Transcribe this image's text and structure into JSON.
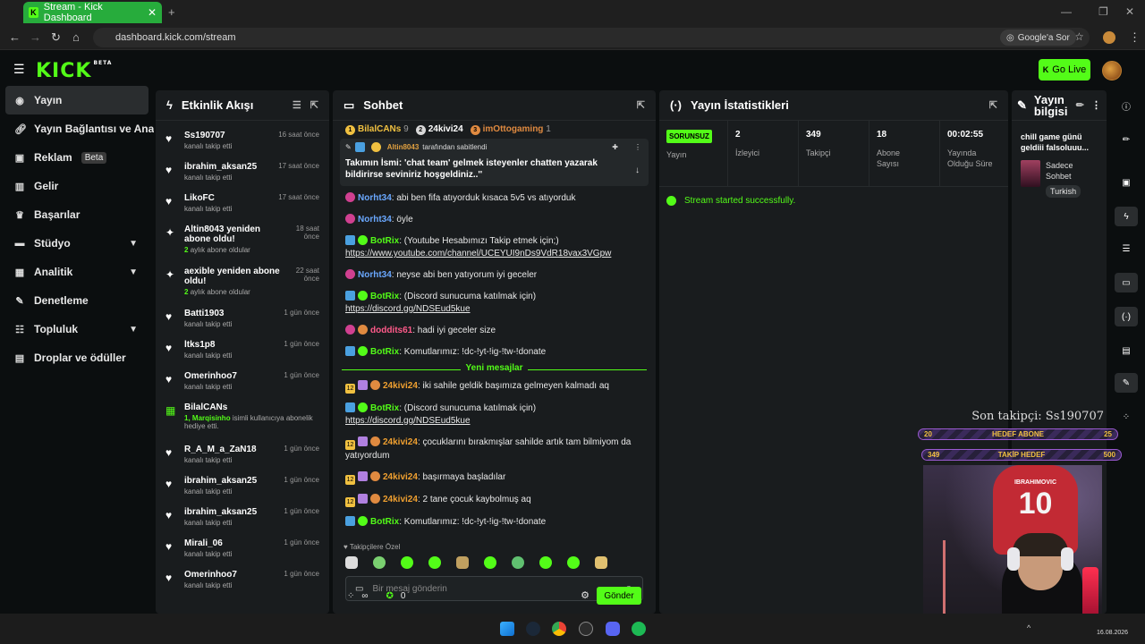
{
  "browser": {
    "tab_title": "Stream - Kick Dashboard",
    "url": "dashboard.kick.com/stream",
    "google_label": "Google'a Sor"
  },
  "header": {
    "logo": "KICK",
    "logo_badge": "BETA",
    "go_live": "Go Live"
  },
  "sidebar": {
    "items": [
      {
        "label": "Yayın",
        "icon": "video-icon"
      },
      {
        "label": "Yayın Bağlantısı ve Anahtarı",
        "icon": "link-icon"
      },
      {
        "label": "Reklam",
        "icon": "ad-icon",
        "badge": "Beta"
      },
      {
        "label": "Gelir",
        "icon": "chart-icon"
      },
      {
        "label": "Başarılar",
        "icon": "trophy-icon"
      },
      {
        "label": "Stüdyo",
        "icon": "studio-icon"
      },
      {
        "label": "Analitik",
        "icon": "analytics-icon"
      },
      {
        "label": "Denetleme",
        "icon": "wrench-icon"
      },
      {
        "label": "Topluluk",
        "icon": "community-icon"
      },
      {
        "label": "Droplar ve ödüller",
        "icon": "drops-icon"
      }
    ]
  },
  "activity": {
    "title": "Etkinlik Akışı",
    "items": [
      {
        "name": "Ss190707",
        "sub": "kanalı takip etti",
        "time": "16 saat önce"
      },
      {
        "name": "ibrahim_aksan25",
        "sub": "kanalı takip etti",
        "time": "17 saat önce"
      },
      {
        "name": "LikoFC",
        "sub": "kanalı takip etti",
        "time": "17 saat önce"
      },
      {
        "name": "Altin8043 yeniden abone oldu!",
        "sub_count": "2",
        "sub": "aylık abone oldular",
        "time": "18 saat önce"
      },
      {
        "name": "aexible yeniden abone oldu!",
        "sub_count": "2",
        "sub": "aylık abone oldular",
        "time": "22 saat önce"
      },
      {
        "name": "Batti1903",
        "sub": "kanalı takip etti",
        "time": "1 gün önce"
      },
      {
        "name": "ltks1p8",
        "sub": "kanalı takip etti",
        "time": "1 gün önce"
      },
      {
        "name": "Omerinhoo7",
        "sub": "kanalı takip etti",
        "time": "1 gün önce"
      },
      {
        "name": "BilalCANs",
        "gift_count": "1,",
        "gift_user": "Marqisinho",
        "sub": "isimli kullanıcıya abonelik hediye etti.",
        "time": ""
      },
      {
        "name": "R_A_M_a_ZaN18",
        "sub": "kanalı takip etti",
        "time": "1 gün önce"
      },
      {
        "name": "ibrahim_aksan25",
        "sub": "kanalı takip etti",
        "time": "1 gün önce"
      },
      {
        "name": "ibrahim_aksan25",
        "sub": "kanalı takip etti",
        "time": "1 gün önce"
      },
      {
        "name": "Mirali_06",
        "sub": "kanalı takip etti",
        "time": "1 gün önce"
      },
      {
        "name": "Omerinhoo7",
        "sub": "kanalı takip etti",
        "time": "1 gün önce"
      }
    ]
  },
  "chat": {
    "title": "Sohbet",
    "top_gifters": [
      {
        "rank": "1",
        "name": "BilalCANs",
        "count": "9",
        "color": "#f0c040"
      },
      {
        "rank": "2",
        "name": "24kivi24",
        "count": "",
        "color": "#d8d8d8"
      },
      {
        "rank": "3",
        "name": "imOttogaming",
        "count": "1",
        "color": "#e08a40"
      }
    ],
    "pinned": {
      "by": "Altin8043",
      "by_suffix": "tarafından sabitlendi",
      "text": "Takımın İsmi: 'chat team' gelmek isteyenler chatten yazarak bildirirse seviniriz hoşgeldiniz..''"
    },
    "messages": [
      {
        "user": "Norht34",
        "color": "#6aa8ff",
        "text": "abi ben fifa atıyorduk kısaca 5v5 vs atıyorduk"
      },
      {
        "user": "Norht34",
        "color": "#6aa8ff",
        "text": "öyle"
      },
      {
        "user": "BotRix",
        "color": "#53fc18",
        "text": "(Youtube Hesabımızı Takip etmek için;)",
        "link": "https://www.youtube.com/channel/UCEYUI9nDs9VdR18vax3VGpw"
      },
      {
        "user": "Norht34",
        "color": "#6aa8ff",
        "text": "neyse abi ben yatıyorum iyi geceler"
      },
      {
        "user": "BotRix",
        "color": "#53fc18",
        "text": "(Discord sunucuma katılmak için)",
        "link": "https://discord.gg/NDSEud5kue"
      },
      {
        "user": "doddits61",
        "color": "#ff5a8a",
        "text": "hadi iyi geceler size"
      },
      {
        "user": "BotRix",
        "color": "#53fc18",
        "text": "Komutlarımız: !dc-!yt-!ig-!tw-!donate"
      }
    ],
    "new_messages_label": "Yeni mesajlar",
    "messages_new": [
      {
        "user": "24kivi24",
        "color": "#f0a030",
        "text": "iki sahile geldik başımıza gelmeyen kalmadı aq"
      },
      {
        "user": "BotRix",
        "color": "#53fc18",
        "text": "(Discord sunucuma katılmak için)",
        "link": "https://discord.gg/NDSEud5kue"
      },
      {
        "user": "24kivi24",
        "color": "#f0a030",
        "text": "çocuklarını bırakmışlar sahilde artık tam bilmiyom da yatıyordum"
      },
      {
        "user": "24kivi24",
        "color": "#f0a030",
        "text": "başırmaya başladılar"
      },
      {
        "user": "24kivi24",
        "color": "#f0a030",
        "text": "2 tane çocuk kaybolmuş aq"
      },
      {
        "user": "BotRix",
        "color": "#53fc18",
        "text": "Komutlarımız: !dc-!yt-!ig-!tw-!donate"
      }
    ],
    "emote_section": "Takipçilere Özel",
    "input_placeholder": "Bir mesaj gönderin",
    "infinity": "∞",
    "points": "0",
    "send": "Gönder"
  },
  "stats": {
    "title": "Yayın İstatistikleri",
    "status_badge": "SORUNSUZ",
    "status_label": "Yayın",
    "cells": [
      {
        "value": "2",
        "label": "İzleyici"
      },
      {
        "value": "349",
        "label": "Takipçi"
      },
      {
        "value": "18",
        "label": "Abone Sayısı"
      },
      {
        "value": "00:02:55",
        "label": "Yayında Olduğu Süre"
      }
    ],
    "log": "Stream started successfully."
  },
  "info": {
    "title": "Yayın bilgisi",
    "stream_title": "chill game günü geldiii falsoluuu...",
    "category": "Sadece Sohbet",
    "tag": "Turkish"
  },
  "overlay": {
    "last_follower": "Son takipçi: Ss190707",
    "sub_goal": {
      "label": "HEDEF ABONE",
      "current": "20",
      "target": "25"
    },
    "follow_goal": {
      "label": "TAKİP HEDEF",
      "current": "349",
      "target": "500"
    },
    "jersey_name": "IBRAHIMOVIC",
    "jersey_number": "10"
  },
  "taskbar": {
    "date": "16.08.2026"
  }
}
